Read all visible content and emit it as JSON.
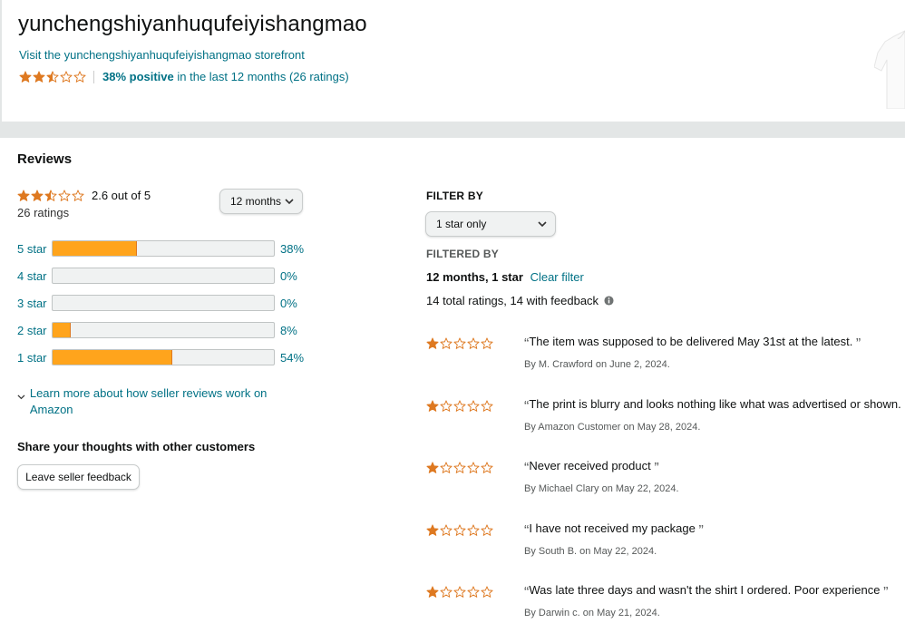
{
  "seller": {
    "name": "yunchengshiyanhuqufeiyishangmao",
    "storefront_link": "Visit the yunchengshiyanhuqufeiyishangmao storefront",
    "rating_stars": 2.5,
    "positive_pct": "38% positive",
    "positive_suffix": " in the last 12 months (26 ratings)"
  },
  "reviews": {
    "title": "Reviews",
    "average": "2.6 out of  5",
    "average_value": 2.6,
    "ratings_count": "26 ratings",
    "period_select": "12 months",
    "histogram": [
      {
        "label": "5 star",
        "percent": 38,
        "text": "38%"
      },
      {
        "label": "4 star",
        "percent": 0,
        "text": "0%"
      },
      {
        "label": "3 star",
        "percent": 0,
        "text": "0%"
      },
      {
        "label": "2 star",
        "percent": 8,
        "text": "8%"
      },
      {
        "label": "1 star",
        "percent": 54,
        "text": "54%"
      }
    ],
    "learn_more": "Learn more about how seller reviews work on Amazon",
    "share_title": "Share your thoughts with other customers",
    "leave_feedback": "Leave seller feedback"
  },
  "filter": {
    "filter_by": "FILTER BY",
    "star_select": "1 star only",
    "filtered_by": "FILTERED BY",
    "state": "12 months, 1 star",
    "clear": "Clear filter",
    "totals": "14 total ratings, 14 with feedback"
  },
  "review_list": [
    {
      "stars": 1,
      "text": "The item was supposed to be delivered May 31st at the latest. ",
      "by": "By M. Crawford on June 2, 2024."
    },
    {
      "stars": 1,
      "text": "The print is blurry and looks nothing like what was advertised or shown. ",
      "by": "By Amazon Customer on May 28, 2024."
    },
    {
      "stars": 1,
      "text": "Never received product ",
      "by": "By Michael Clary on May 22, 2024."
    },
    {
      "stars": 1,
      "text": "I have not received my package ",
      "by": "By South B. on May 22, 2024."
    },
    {
      "stars": 1,
      "text": "Was late three days and wasn't the shirt I ordered. Poor experience ",
      "by": "By Darwin c. on May 21, 2024."
    }
  ],
  "colors": {
    "link": "#007185",
    "star": "#de7921",
    "bar_fill": "#ffa41c"
  }
}
